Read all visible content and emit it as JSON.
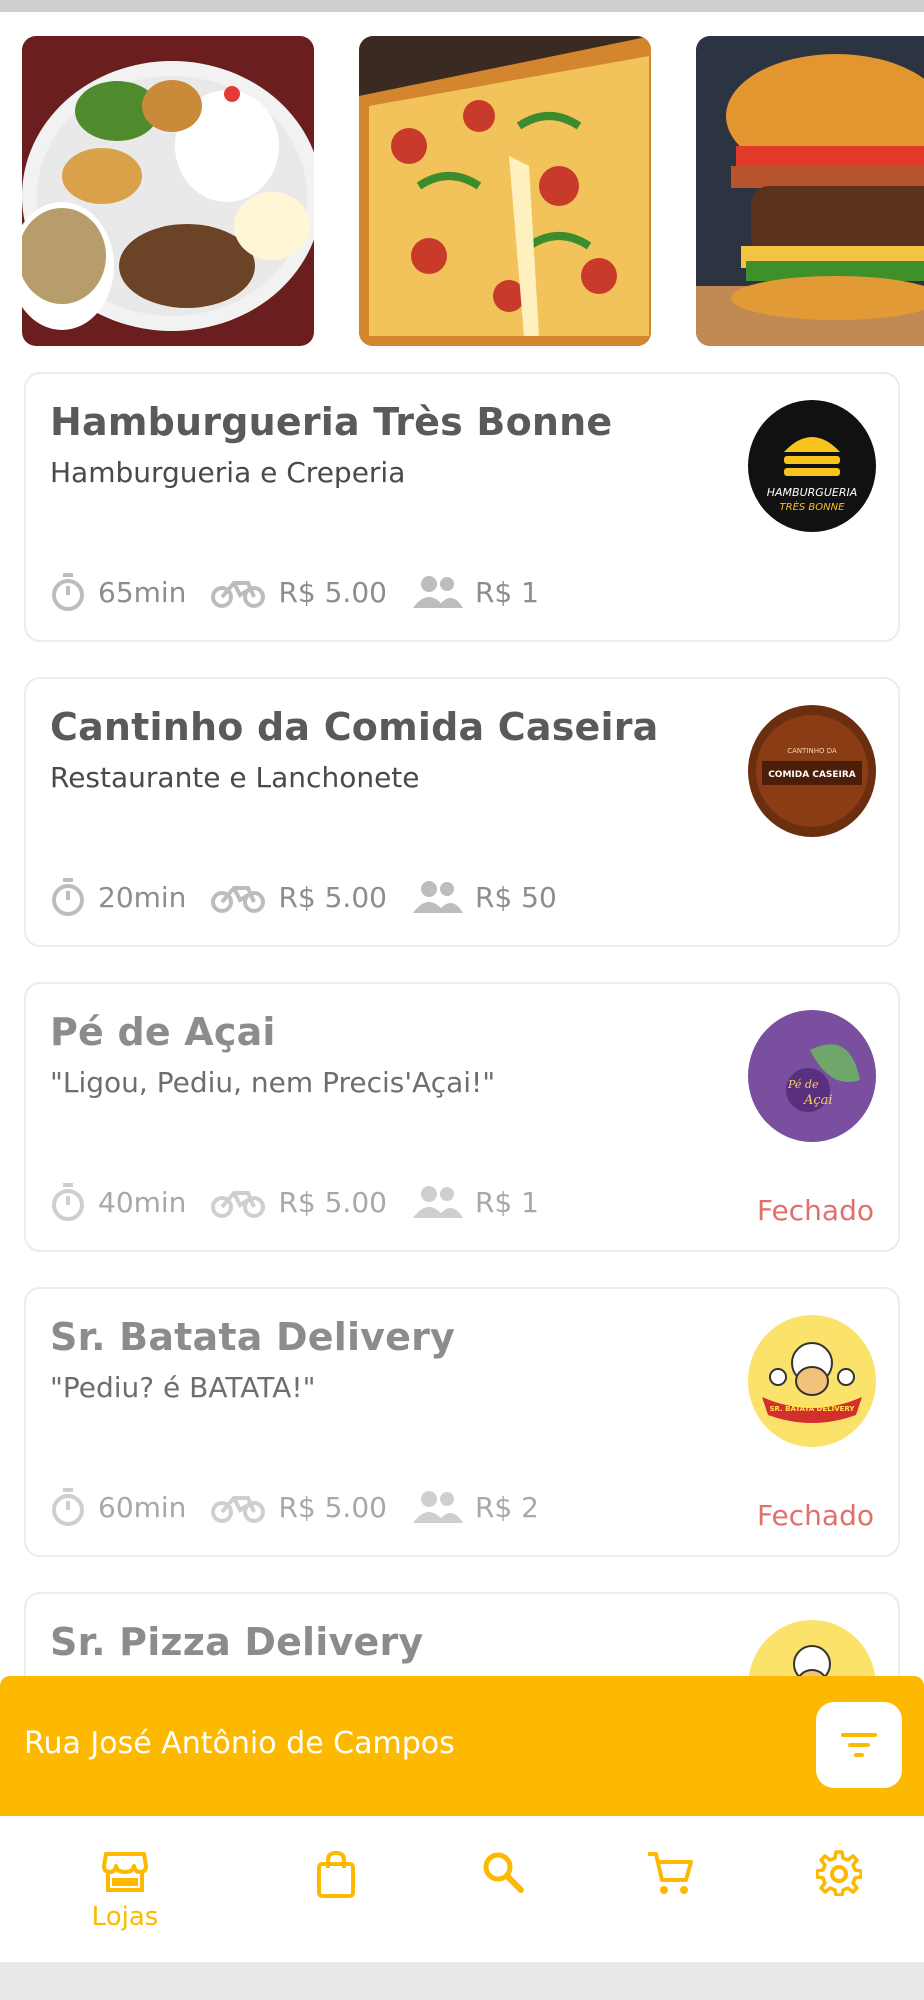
{
  "colors": {
    "accent": "#fdb900",
    "closed_status": "#e0706a",
    "text_dark": "#5a5a5a",
    "text_muted": "#8d8d8d"
  },
  "banners": [
    {
      "name": "banner-food-plate"
    },
    {
      "name": "banner-pizza"
    },
    {
      "name": "banner-burger"
    }
  ],
  "stores": [
    {
      "name": "Hamburgueria Très Bonne",
      "subtitle": "Hamburgueria e Creperia",
      "time": "65min",
      "delivery_fee": "R$ 5.00",
      "min_order": "R$ 1",
      "status": "",
      "logo_text_1": "HAMBURGUERIA",
      "logo_text_2": "TRÈS BONNE"
    },
    {
      "name": "Cantinho da Comida Caseira",
      "subtitle": "Restaurante e Lanchonete",
      "time": "20min",
      "delivery_fee": "R$ 5.00",
      "min_order": "R$ 50",
      "status": "",
      "logo_text_1": "CANTINHO DA",
      "logo_text_2": "COMIDA CASEIRA"
    },
    {
      "name": "Pé de Açai",
      "subtitle": "\"Ligou, Pediu, nem Precis'Açai!\"",
      "time": "40min",
      "delivery_fee": "R$ 5.00",
      "min_order": "R$ 1",
      "status": "Fechado",
      "logo_text_1": "Pé de",
      "logo_text_2": "Açai"
    },
    {
      "name": "Sr. Batata Delivery",
      "subtitle": "\"Pediu? é BATATA!\"",
      "time": "60min",
      "delivery_fee": "R$ 5.00",
      "min_order": "R$ 2",
      "status": "Fechado",
      "logo_text_1": "SR. BATATA DELIVERY",
      "logo_text_2": ""
    },
    {
      "name": "Sr. Pizza Delivery",
      "subtitle": "",
      "time": "",
      "delivery_fee": "",
      "min_order": "",
      "status": ""
    }
  ],
  "address_bar": {
    "address": "Rua José Antônio de Campos",
    "filter_icon": "filter-icon"
  },
  "bottom_nav": {
    "items": [
      {
        "icon": "store-icon",
        "label": "Lojas",
        "active": true
      },
      {
        "icon": "shopping-bag-icon",
        "label": "",
        "active": false
      },
      {
        "icon": "search-icon",
        "label": "",
        "active": false
      },
      {
        "icon": "cart-icon",
        "label": "",
        "active": false
      },
      {
        "icon": "gear-icon",
        "label": "",
        "active": false
      }
    ]
  }
}
